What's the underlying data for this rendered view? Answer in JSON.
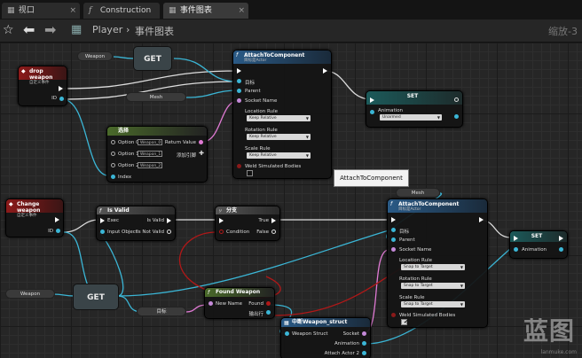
{
  "tabs": [
    {
      "label": "视口",
      "icon": "viewport-icon"
    },
    {
      "label": "Construction Scrip",
      "icon": "function-icon"
    },
    {
      "label": "事件图表",
      "icon": "graph-icon"
    }
  ],
  "breadcrumb": {
    "root": "Player",
    "separator": "›",
    "current": "事件图表",
    "zoom": "缩放-3"
  },
  "tooltip": "AttachToComponent",
  "nodes": {
    "drop_weapon": {
      "title": "drop weapon",
      "subtitle": "自定义事件",
      "pin_id": "ID"
    },
    "weapon_var_1": "Weapon",
    "get_1": "GET",
    "mesh_var_1": "Mesh",
    "attach_1": {
      "title": "AttachToComponent",
      "subtitle": "目标是Actor",
      "pins": [
        "目标",
        "Parent",
        "Socket Name"
      ],
      "location_rule": "Location Rule",
      "location_value": "Keep Relative",
      "rotation_rule": "Rotation Rule",
      "rotation_value": "Keep Relative",
      "scale_rule": "Scale Rule",
      "scale_value": "Keep Relative",
      "weld": "Weld Simulated Bodies"
    },
    "set_1": {
      "title": "SET",
      "pin": "Animation",
      "value": "Unarmed"
    },
    "select": {
      "title": "选择",
      "options": [
        {
          "label": "Option 0",
          "value": "Weapon_0"
        },
        {
          "label": "Option 1",
          "value": "Weapon_1"
        },
        {
          "label": "Option 2",
          "value": "Weapon_2"
        }
      ],
      "index": "Index",
      "return_value": "Return Value",
      "add_pin": "添加引脚"
    },
    "change_weapon": {
      "title": "Change weapon",
      "subtitle": "自定义事件",
      "pin_id": "ID"
    },
    "is_valid": {
      "title": "Is Valid",
      "exec": "Exec",
      "input": "Input Object",
      "is_valid": "Is Valid",
      "not_valid": "Is Not Valid"
    },
    "branch": {
      "title": "分支",
      "condition": "Condition",
      "true": "True",
      "false": "False"
    },
    "mesh_var_2": "Mesh",
    "attach_2": {
      "title": "AttachToComponent",
      "subtitle": "目标是Actor",
      "pins": [
        "目标",
        "Parent",
        "Socket Name"
      ],
      "location_rule": "Location Rule",
      "location_value": "Snap to Target",
      "rotation_rule": "Rotation Rule",
      "rotation_value": "Snap to Target",
      "scale_rule": "Scale Rule",
      "scale_value": "Snap to Target",
      "weld": "Weld Simulated Bodies"
    },
    "set_2": {
      "title": "SET",
      "pin": "Animation"
    },
    "weapon_var_2": "Weapon",
    "get_2": "GET",
    "target_pin": "目标",
    "found_weapon": {
      "title": "Found Weapon",
      "new_name": "New Name",
      "found": "Found",
      "output": "输出行"
    },
    "break_struct": {
      "title": "中断Weapon_struct",
      "input": "Weapon Struct",
      "socket": "Socket",
      "animation": "Animation",
      "attach": "Attach Actor 2"
    }
  },
  "watermark": {
    "main": "蓝图",
    "small": "lanmuke.com"
  }
}
